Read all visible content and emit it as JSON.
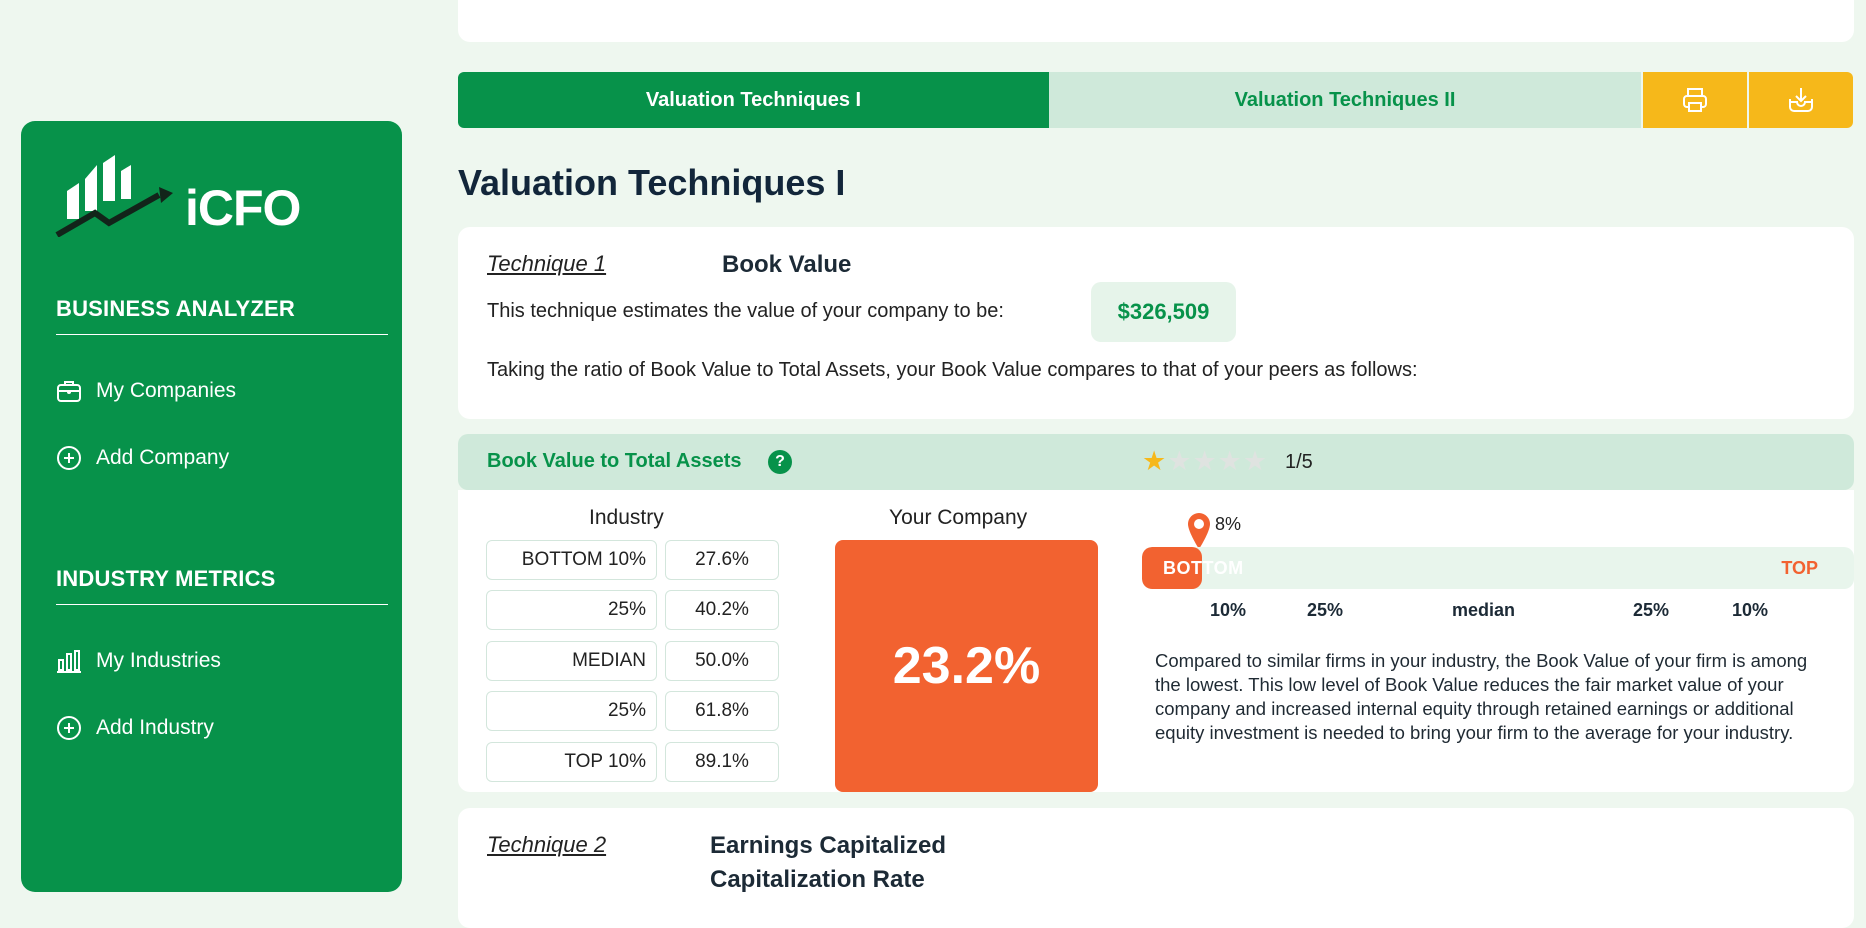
{
  "sidebar": {
    "logo_text": "iCFO",
    "sections": [
      {
        "title": "BUSINESS ANALYZER",
        "items": [
          {
            "label": "My Companies",
            "icon": "briefcase-icon"
          },
          {
            "label": "Add Company",
            "icon": "plus-circle-icon"
          }
        ]
      },
      {
        "title": "INDUSTRY METRICS",
        "items": [
          {
            "label": "My Industries",
            "icon": "bar-chart-icon"
          },
          {
            "label": "Add Industry",
            "icon": "plus-circle-icon"
          }
        ]
      }
    ]
  },
  "tabs": [
    {
      "label": "Valuation Techniques I",
      "active": true
    },
    {
      "label": "Valuation Techniques II",
      "active": false
    }
  ],
  "toolbar": {
    "print_icon": "print-icon",
    "download_icon": "download-icon"
  },
  "page_title": "Valuation Techniques I",
  "technique1": {
    "label": "Technique 1",
    "name": "Book Value",
    "estimate_text": "This technique estimates the value of your company to be:",
    "estimate_value": "$326,509",
    "compare_text": "Taking the ratio of Book Value to Total Assets, your Book Value compares to that of your peers as follows:"
  },
  "metric": {
    "title": "Book Value to Total Assets",
    "help_icon": "question-icon",
    "rating": 1,
    "rating_max": 5,
    "rating_text": "1/5",
    "industry_heading": "Industry",
    "company_heading": "Your Company",
    "industry_rows": [
      {
        "label": "BOTTOM 10%",
        "value": "27.6%"
      },
      {
        "label": "25%",
        "value": "40.2%"
      },
      {
        "label": "MEDIAN",
        "value": "50.0%"
      },
      {
        "label": "25%",
        "value": "61.8%"
      },
      {
        "label": "TOP 10%",
        "value": "89.1%"
      }
    ],
    "company_value": "23.2%",
    "percentile_text": "8%",
    "percentile": 0.08,
    "range_bottom_label": "BOTTOM",
    "range_top_label": "TOP",
    "range_ticks": [
      "10%",
      "25%",
      "median",
      "25%",
      "10%"
    ],
    "description": "Compared to similar firms in your industry, the Book Value of your firm is among the lowest. This low level of Book Value reduces the fair market value of your company and increased internal equity through retained earnings or additional equity investment is needed to bring your firm to the average for your industry.",
    "colors": {
      "low": "#f26230",
      "brand": "#07924a",
      "star": "#f6b81a"
    }
  },
  "technique2": {
    "label": "Technique 2",
    "name_line1": "Earnings Capitalized",
    "name_line2": "Capitalization Rate"
  }
}
